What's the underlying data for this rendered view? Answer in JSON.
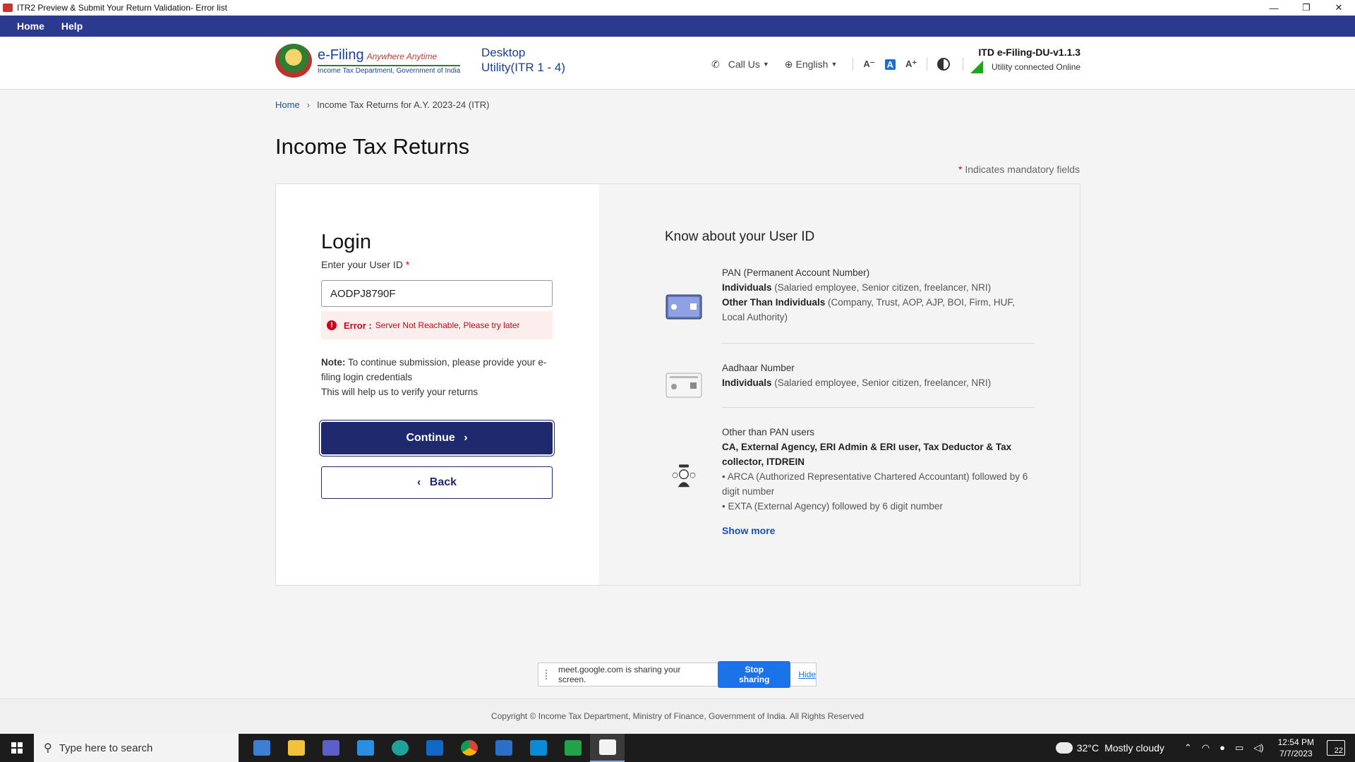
{
  "window": {
    "title": "ITR2 Preview & Submit Your Return Validation- Error list",
    "minimize": "—",
    "restore": "❐",
    "close": "✕"
  },
  "menubar": {
    "items": [
      "Home",
      "Help"
    ]
  },
  "header": {
    "logo_main": "e-Filing",
    "logo_tagline": "Anywhere Anytime",
    "logo_sub": "Income Tax Department, Government of India",
    "product_title_1": "Desktop",
    "product_title_2": "Utility(ITR 1 - 4)",
    "call_us": "Call Us",
    "language": "English",
    "font_decrease": "A⁻",
    "font_normal": "A",
    "font_increase": "A⁺",
    "version": "ITD e-Filing-DU-v1.1.3",
    "connection_status": "Utility connected Online"
  },
  "breadcrumb": {
    "home": "Home",
    "current": "Income Tax Returns for A.Y. 2023-24 (ITR)"
  },
  "page": {
    "title": "Income Tax Returns",
    "mandatory_star": "*",
    "mandatory_note": "Indicates mandatory fields"
  },
  "login": {
    "heading": "Login",
    "user_id_label": "Enter your User ID",
    "required_star": "*",
    "user_id_value": "AODPJ8790F",
    "error_label": "Error :",
    "error_message": "Server Not Reachable, Please try later",
    "note_label": "Note:",
    "note_text": "To continue submission, please provide your e-filing login credentials",
    "note_text_2": "This will help us to verify your returns",
    "continue_label": "Continue",
    "back_label": "Back"
  },
  "user_id_info": {
    "heading": "Know about your User ID",
    "pan": {
      "title": "PAN (Permanent Account Number)",
      "line1_bold": "Individuals",
      "line1_rest": "(Salaried employee, Senior citizen, freelancer, NRI)",
      "line2_bold": "Other Than Individuals",
      "line2_rest": "(Company, Trust, AOP, AJP, BOI, Firm, HUF, Local Authority)"
    },
    "aadhaar": {
      "title": "Aadhaar Number",
      "line1_bold": "Individuals",
      "line1_rest": "(Salaried employee, Senior citizen, freelancer, NRI)"
    },
    "other": {
      "title": "Other than PAN users",
      "line1_bold": "CA, External Agency, ERI Admin & ERI user, Tax Deductor & Tax collector, ITDREIN",
      "bullet1": "• ARCA (Authorized Representative Chartered Accountant) followed by 6 digit number",
      "bullet2": "• EXTA (External Agency) followed by 6 digit number"
    },
    "show_more": "Show more"
  },
  "screen_share": {
    "message": "meet.google.com is sharing your screen.",
    "stop_label": "Stop sharing",
    "hide_label": "Hide"
  },
  "footer": {
    "copyright": "Copyright © Income Tax Department, Ministry of Finance, Government of India. All Rights Reserved"
  },
  "taskbar": {
    "search_placeholder": "Type here to search",
    "weather_temp": "32°C",
    "weather_text": "Mostly cloudy",
    "time": "12:54 PM",
    "date": "7/7/2023",
    "notification_count": "22"
  },
  "colors": {
    "menubar": "#2b3a8f",
    "primary_button": "#1f2a6e",
    "link": "#1a4fb5",
    "error": "#d0021b",
    "online": "#21a31f"
  }
}
